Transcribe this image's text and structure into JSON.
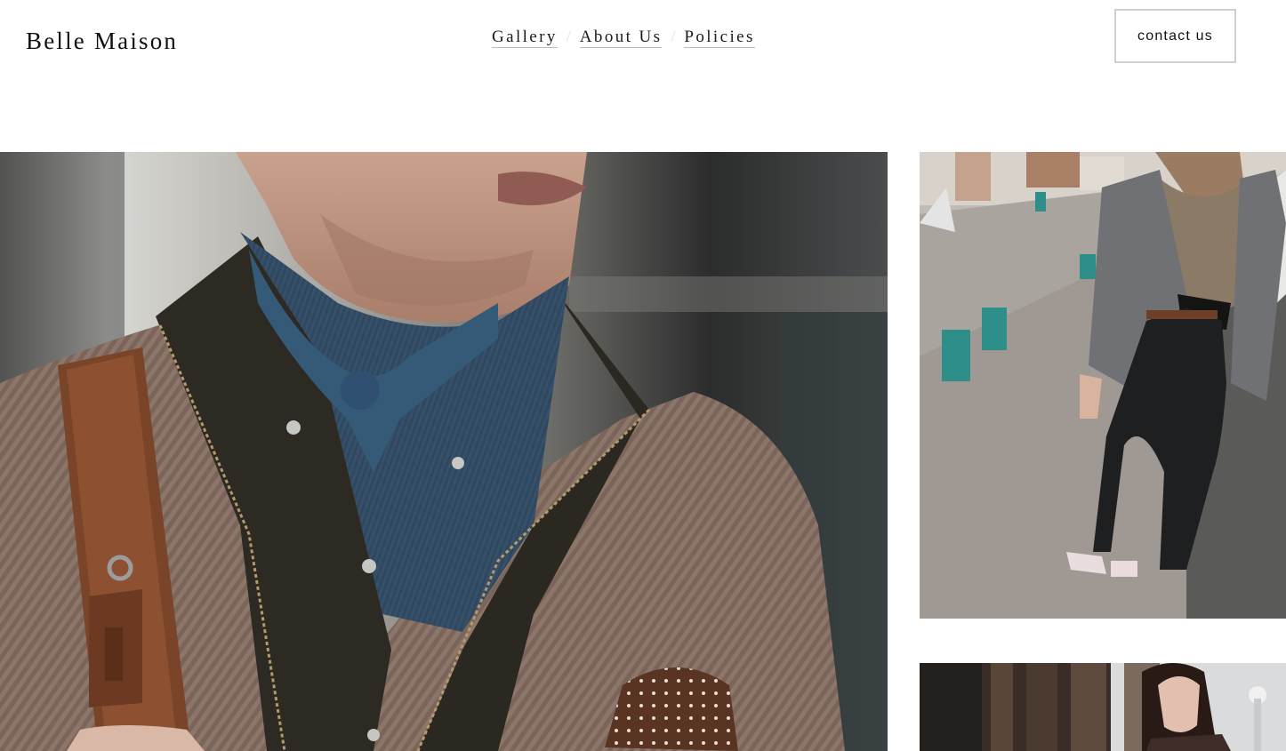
{
  "header": {
    "brand": "Belle Maison",
    "nav": [
      {
        "label": "Gallery"
      },
      {
        "label": "About Us"
      },
      {
        "label": "Policies"
      }
    ],
    "nav_separator": "/",
    "contact_label": "contact us"
  },
  "gallery": {
    "photos": [
      {
        "name": "gallery-photo-man-scarf"
      },
      {
        "name": "gallery-photo-woman-street"
      },
      {
        "name": "gallery-photo-woman-portrait"
      }
    ]
  },
  "colors": {
    "text": "#111111",
    "button_border": "#cfcfcf",
    "background": "#ffffff"
  }
}
